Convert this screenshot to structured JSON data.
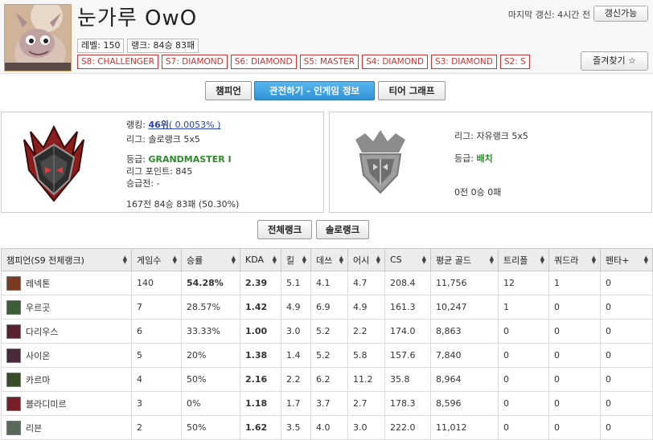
{
  "header": {
    "summoner_name": "눈가루 OwO",
    "level_text": "레벨: 150",
    "rank_text": "랭크: 84승 83패",
    "seasons": [
      "S8: CHALLENGER",
      "S7: DIAMOND",
      "S6: DIAMOND",
      "S5: MASTER",
      "S4: DIAMOND",
      "S3: DIAMOND",
      "S2: S"
    ],
    "last_update": "마지막 갱신: 4시간 전",
    "update_button": "갱신가능",
    "favorite_button": "즐겨찾기 ☆"
  },
  "tabs": [
    "챔피언",
    "관전하기 - 인게임 정보",
    "티어 그래프"
  ],
  "active_tab": "관전하기 - 인게임 정보",
  "solo_rank": {
    "ranking_label": "랭킹: ",
    "ranking_value": "46위",
    "ranking_percent": "( 0.0053% )",
    "league": "리그: 솔로랭크 5x5",
    "tier_label": "등급: ",
    "tier_value": "GRANDMASTER I",
    "league_points": "리그 포인트: 845",
    "promo": "승급전: -",
    "record": "167전 84승 83패 (50.30%)"
  },
  "flex_rank": {
    "league": "리그: 자유랭크 5x5",
    "tier_label": "등급: ",
    "tier_value": "배치",
    "record": "0전 0승 0패"
  },
  "rank_type_buttons": [
    "전체랭크",
    "솔로랭크"
  ],
  "table": {
    "headers": [
      "챔피언(S9 전체랭크)",
      "게임수",
      "승률",
      "KDA",
      "킬",
      "데쓰",
      "어시",
      "CS",
      "평균 골드",
      "트리플",
      "쿼드라",
      "펜타+"
    ],
    "rows": [
      {
        "champion": "레넥톤",
        "games": "140",
        "winrate": "54.28%",
        "kda": "2.39",
        "kills": "5.1",
        "deaths": "4.1",
        "assists": "4.7",
        "cs": "208.4",
        "gold": "11,756",
        "triple": "12",
        "quadra": "1",
        "penta": "0"
      },
      {
        "champion": "우르곳",
        "games": "7",
        "winrate": "28.57%",
        "kda": "1.42",
        "kills": "4.9",
        "deaths": "6.9",
        "assists": "4.9",
        "cs": "161.3",
        "gold": "10,247",
        "triple": "1",
        "quadra": "0",
        "penta": "0"
      },
      {
        "champion": "다리우스",
        "games": "6",
        "winrate": "33.33%",
        "kda": "1.00",
        "kills": "3.0",
        "deaths": "5.2",
        "assists": "2.2",
        "cs": "174.0",
        "gold": "8,863",
        "triple": "0",
        "quadra": "0",
        "penta": "0"
      },
      {
        "champion": "사이온",
        "games": "5",
        "winrate": "20%",
        "kda": "1.38",
        "kills": "1.4",
        "deaths": "5.2",
        "assists": "5.8",
        "cs": "157.6",
        "gold": "7,840",
        "triple": "0",
        "quadra": "0",
        "penta": "0"
      },
      {
        "champion": "카르마",
        "games": "4",
        "winrate": "50%",
        "kda": "2.16",
        "kills": "2.2",
        "deaths": "6.2",
        "assists": "11.2",
        "cs": "35.8",
        "gold": "8,964",
        "triple": "0",
        "quadra": "0",
        "penta": "0"
      },
      {
        "champion": "블라디미르",
        "games": "3",
        "winrate": "0%",
        "kda": "1.18",
        "kills": "1.7",
        "deaths": "3.7",
        "assists": "2.7",
        "cs": "178.3",
        "gold": "8,596",
        "triple": "0",
        "quadra": "0",
        "penta": "0"
      },
      {
        "champion": "리븐",
        "games": "2",
        "winrate": "50%",
        "kda": "1.62",
        "kills": "3.5",
        "deaths": "4.0",
        "assists": "3.0",
        "cs": "222.0",
        "gold": "11,012",
        "triple": "0",
        "quadra": "0",
        "penta": "0"
      }
    ]
  },
  "colors": {
    "accent_blue": "#2f93d6",
    "link_blue": "#2541b2",
    "good_green": "#2d8a2d",
    "season_red": "#cc3333"
  }
}
